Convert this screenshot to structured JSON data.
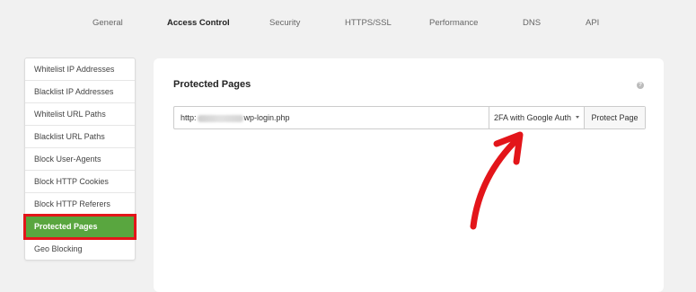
{
  "nav": {
    "tabs": [
      {
        "label": "General"
      },
      {
        "label": "Access Control"
      },
      {
        "label": "Security"
      },
      {
        "label": "HTTPS/SSL"
      },
      {
        "label": "Performance"
      },
      {
        "label": "DNS"
      },
      {
        "label": "API"
      }
    ],
    "active_tab": "Access Control"
  },
  "sidebar": {
    "items": [
      {
        "label": "Whitelist IP Addresses"
      },
      {
        "label": "Blacklist IP Addresses"
      },
      {
        "label": "Whitelist URL Paths"
      },
      {
        "label": "Blacklist URL Paths"
      },
      {
        "label": "Block User-Agents"
      },
      {
        "label": "Block HTTP Cookies"
      },
      {
        "label": "Block HTTP Referers"
      },
      {
        "label": "Protected Pages"
      },
      {
        "label": "Geo Blocking"
      }
    ],
    "active_item": "Protected Pages"
  },
  "panel": {
    "title": "Protected Pages",
    "help_icon": "question-icon",
    "url_prefix": "http:",
    "url_suffix": "wp-login.php",
    "auth_method": "2FA with Google Auth",
    "protect_button": "Protect Page"
  },
  "colors": {
    "active_item_bg": "#59a63f",
    "highlight_border": "#e3151a",
    "annotation_arrow": "#e3151a"
  }
}
